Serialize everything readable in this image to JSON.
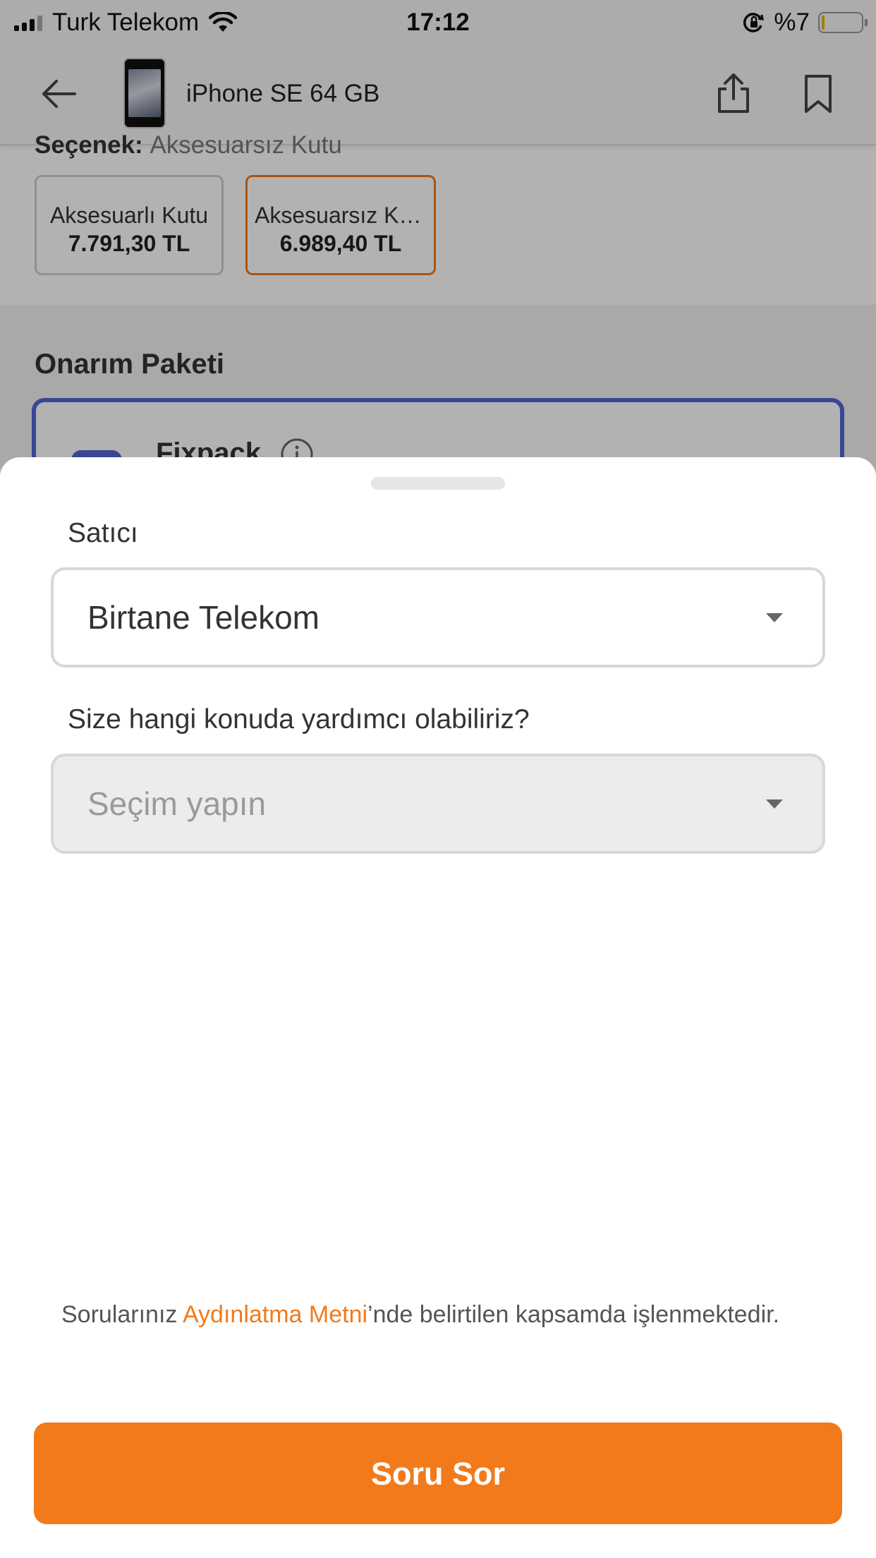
{
  "status_bar": {
    "carrier": "Turk Telekom",
    "time": "17:12",
    "battery": "%7",
    "battery_level": 0.07
  },
  "header": {
    "title": "iPhone SE 64 GB"
  },
  "options": {
    "label": "Seçenek:",
    "selected": "Aksesuarsız Kutu",
    "items": [
      {
        "name": "Aksesuarlı Kutu",
        "price": "7.791,30 TL"
      },
      {
        "name": "Aksesuarsız Kutu",
        "price": "6.989,40 TL"
      }
    ]
  },
  "repair": {
    "section_title": "Onarım Paketi",
    "package_name": "Fixpack"
  },
  "sheet": {
    "seller_label": "Satıcı",
    "seller_value": "Birtane Telekom",
    "topic_label": "Size hangi konuda yardımcı olabiliriz?",
    "topic_placeholder": "Seçim yapın",
    "privacy_prefix": "Sorularınız ",
    "privacy_link": "Aydınlatma Metni",
    "privacy_suffix": "’nde belirtilen kapsamda işlenmektedir.",
    "submit_label": "Soru Sor"
  },
  "colors": {
    "accent": "#f27a1a",
    "repair_border": "#5465d6"
  }
}
